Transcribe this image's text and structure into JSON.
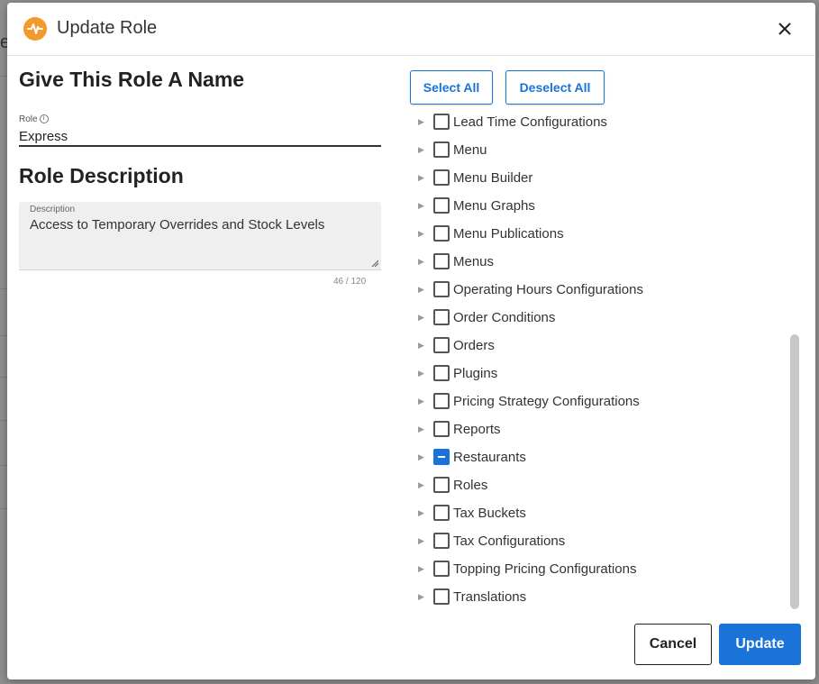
{
  "dialog": {
    "title": "Update Role",
    "app_icon": "pulse-icon",
    "close_icon": "close-icon"
  },
  "form": {
    "name_heading": "Give This Role A Name",
    "role_label": "Role",
    "role_info_icon": "info-icon",
    "role_value": "Express",
    "description_heading": "Role Description",
    "description_label": "Description",
    "description_value": "Access to Temporary Overrides and Stock Levels",
    "counter": "46 / 120"
  },
  "permissions": {
    "select_all_label": "Select All",
    "deselect_all_label": "Deselect All",
    "items": [
      {
        "label": "Lead Time Configurations",
        "state": "unchecked"
      },
      {
        "label": "Menu",
        "state": "unchecked"
      },
      {
        "label": "Menu Builder",
        "state": "unchecked"
      },
      {
        "label": "Menu Graphs",
        "state": "unchecked"
      },
      {
        "label": "Menu Publications",
        "state": "unchecked"
      },
      {
        "label": "Menus",
        "state": "unchecked"
      },
      {
        "label": "Operating Hours Configurations",
        "state": "unchecked"
      },
      {
        "label": "Order Conditions",
        "state": "unchecked"
      },
      {
        "label": "Orders",
        "state": "unchecked"
      },
      {
        "label": "Plugins",
        "state": "unchecked"
      },
      {
        "label": "Pricing Strategy Configurations",
        "state": "unchecked"
      },
      {
        "label": "Reports",
        "state": "unchecked"
      },
      {
        "label": "Restaurants",
        "state": "indeterminate"
      },
      {
        "label": "Roles",
        "state": "unchecked"
      },
      {
        "label": "Tax Buckets",
        "state": "unchecked"
      },
      {
        "label": "Tax Configurations",
        "state": "unchecked"
      },
      {
        "label": "Topping Pricing Configurations",
        "state": "unchecked"
      },
      {
        "label": "Translations",
        "state": "unchecked"
      }
    ]
  },
  "footer": {
    "cancel_label": "Cancel",
    "update_label": "Update"
  },
  "colors": {
    "accent": "#1a73d9",
    "app_icon": "#f39a2d"
  }
}
